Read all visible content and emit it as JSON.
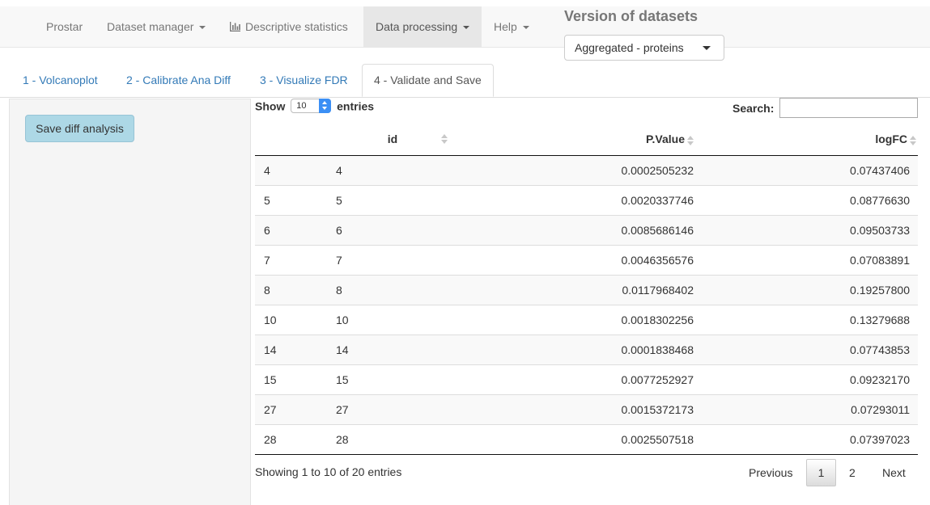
{
  "navbar": {
    "brand": "Prostar",
    "items": [
      {
        "label": "Dataset manager",
        "has_caret": true
      },
      {
        "label": "Descriptive statistics",
        "icon": "bar-chart-icon"
      },
      {
        "label": "Data processing",
        "has_caret": true,
        "active": true
      },
      {
        "label": "Help",
        "has_caret": true
      }
    ],
    "version_label": "Version of datasets",
    "version_selected": "Aggregated - proteins"
  },
  "tabs": [
    {
      "label": "1 - Volcanoplot"
    },
    {
      "label": "2 - Calibrate Ana Diff"
    },
    {
      "label": "3 - Visualize FDR"
    },
    {
      "label": "4 - Validate and Save",
      "active": true
    }
  ],
  "sidebar": {
    "save_button": "Save diff analysis"
  },
  "table": {
    "show_label": "Show",
    "page_length": "10",
    "entries_label": "entries",
    "search_label": "Search:",
    "search_value": "",
    "columns": [
      "",
      "id",
      "P.Value",
      "logFC"
    ],
    "rows": [
      [
        "4",
        "4",
        "0.0002505232",
        "0.07437406"
      ],
      [
        "5",
        "5",
        "0.0020337746",
        "0.08776630"
      ],
      [
        "6",
        "6",
        "0.0085686146",
        "0.09503733"
      ],
      [
        "7",
        "7",
        "0.0046356576",
        "0.07083891"
      ],
      [
        "8",
        "8",
        "0.0117968402",
        "0.19257800"
      ],
      [
        "10",
        "10",
        "0.0018302256",
        "0.13279688"
      ],
      [
        "14",
        "14",
        "0.0001838468",
        "0.07743853"
      ],
      [
        "15",
        "15",
        "0.0077252927",
        "0.09232170"
      ],
      [
        "27",
        "27",
        "0.0015372173",
        "0.07293011"
      ],
      [
        "28",
        "28",
        "0.0025507518",
        "0.07397023"
      ]
    ],
    "info": "Showing 1 to 10 of 20 entries",
    "pagination": {
      "previous": "Previous",
      "pages": [
        "1",
        "2"
      ],
      "current": "1",
      "next": "Next"
    }
  }
}
